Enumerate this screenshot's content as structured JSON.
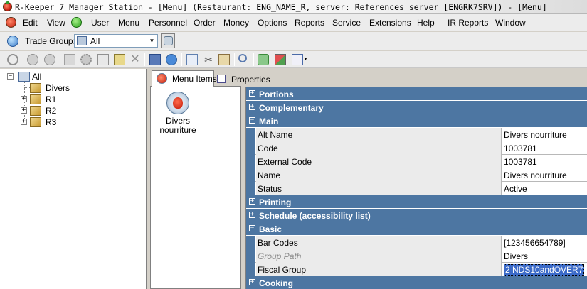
{
  "window": {
    "title": "R-Keeper 7 Manager Station - [Menu] (Restaurant: ENG_NAME_R, server: References server [ENGRK7SRV]) - [Menu]"
  },
  "menubar": {
    "items": [
      "Edit",
      "View",
      "User",
      "Menu",
      "Personnel",
      "Order",
      "Money",
      "Options",
      "Reports",
      "Service",
      "Extensions",
      "Help",
      "IR Reports",
      "Window"
    ]
  },
  "trade_group": {
    "label": "Trade Group:",
    "value": "All"
  },
  "toolbar": {
    "icons": [
      "refresh-icon",
      "back-icon",
      "forward-icon",
      "tree-icon",
      "settings-icon",
      "copy-icon",
      "export-icon",
      "delete-icon",
      "save-icon",
      "undo-icon",
      "duplicate-icon",
      "cut-icon",
      "paste-icon",
      "search-icon",
      "filter-icon",
      "link-icon",
      "grid-view-icon"
    ]
  },
  "tree": {
    "root": "All",
    "children": [
      "Divers",
      "R1",
      "R2",
      "R3"
    ]
  },
  "tabs": [
    "Menu Items",
    "Properties"
  ],
  "items": [
    {
      "label": "Divers nourriture"
    }
  ],
  "grid": {
    "rows": [
      {
        "type": "section",
        "label": "Portions",
        "expanded": false
      },
      {
        "type": "section",
        "label": "Complementary",
        "expanded": false
      },
      {
        "type": "section",
        "label": "Main",
        "expanded": true
      },
      {
        "type": "prop",
        "label": "Alt Name",
        "value": "Divers nourriture"
      },
      {
        "type": "prop",
        "label": "Code",
        "value": "1003781"
      },
      {
        "type": "prop",
        "label": "External Code",
        "value": "1003781"
      },
      {
        "type": "prop",
        "label": "Name",
        "value": "Divers nourriture"
      },
      {
        "type": "prop",
        "label": "Status",
        "value": "Active"
      },
      {
        "type": "section",
        "label": "Printing",
        "expanded": false
      },
      {
        "type": "section",
        "label": "Schedule (accessibility list)",
        "expanded": false
      },
      {
        "type": "section",
        "label": "Basic",
        "expanded": true
      },
      {
        "type": "prop",
        "label": "Bar Codes",
        "value": "[123456654789]"
      },
      {
        "type": "prop",
        "label": "Group Path",
        "value": "Divers",
        "disabled": true
      },
      {
        "type": "prop",
        "label": "Fiscal Group",
        "value": "2 NDS10andOVER7",
        "selected": true
      },
      {
        "type": "section",
        "label": "Cooking",
        "expanded": false
      }
    ]
  },
  "colors": {
    "section_bg": "#4d76a2",
    "selection": "#3b6ac8",
    "chrome": "#ececec"
  }
}
